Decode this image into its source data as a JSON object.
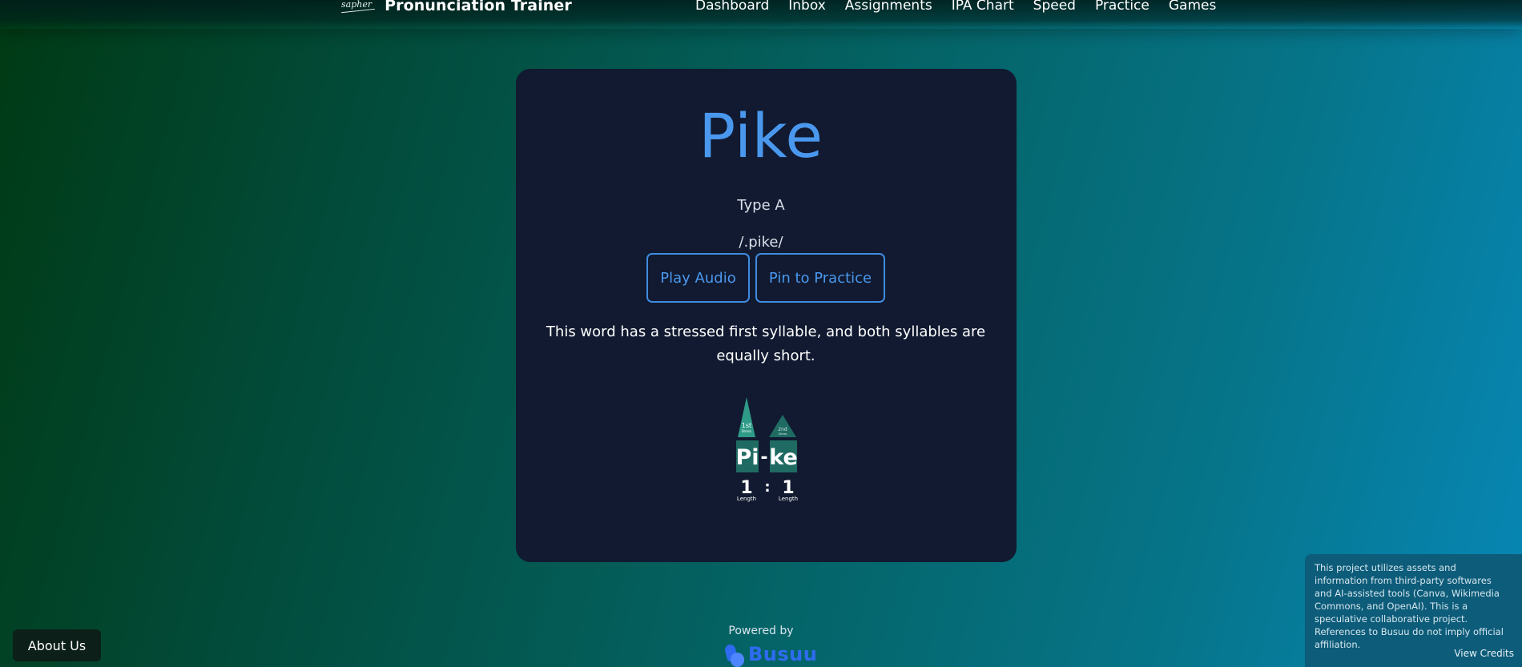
{
  "header": {
    "logo_text": "sapher",
    "app_title": "Pronunciation Trainer",
    "nav": [
      "Dashboard",
      "Inbox",
      "Assignments",
      "IPA Chart",
      "Speed",
      "Practice",
      "Games"
    ]
  },
  "word_card": {
    "word": "Pike",
    "type": "Type A",
    "ipa": "/.pike/",
    "play_button": "Play Audio",
    "pin_button": "Pin to Practice",
    "description": "This word has a stressed first syllable, and both syllables are equally short.",
    "stress_graphic": {
      "first_marker": [
        "1st",
        "Stress"
      ],
      "second_marker": [
        "2nd",
        "Stress"
      ],
      "syllable_1": "Pi",
      "hyphen": "-",
      "syllable_2": "ke",
      "length_1": "1",
      "ratio_separator": ":",
      "length_2": "1",
      "length_label": "Length"
    }
  },
  "footer": {
    "about_button": "About Us",
    "powered_by": "Powered by",
    "brand": "Busuu",
    "credits_text": "This project utilizes assets and information from third-party softwares and AI-assisted tools (Canva, Wikimedia Commons, and OpenAI). This is a speculative collaborative project. References to Busuu do not imply official affiliation.",
    "view_credits": "View Credits"
  },
  "colors": {
    "accent": "#4a98ee",
    "card_bg": "#111a30",
    "graphic_teal": "#1f6b63",
    "graphic_teal_light": "#2e9a88",
    "brand_blue": "#2f6bf0"
  }
}
